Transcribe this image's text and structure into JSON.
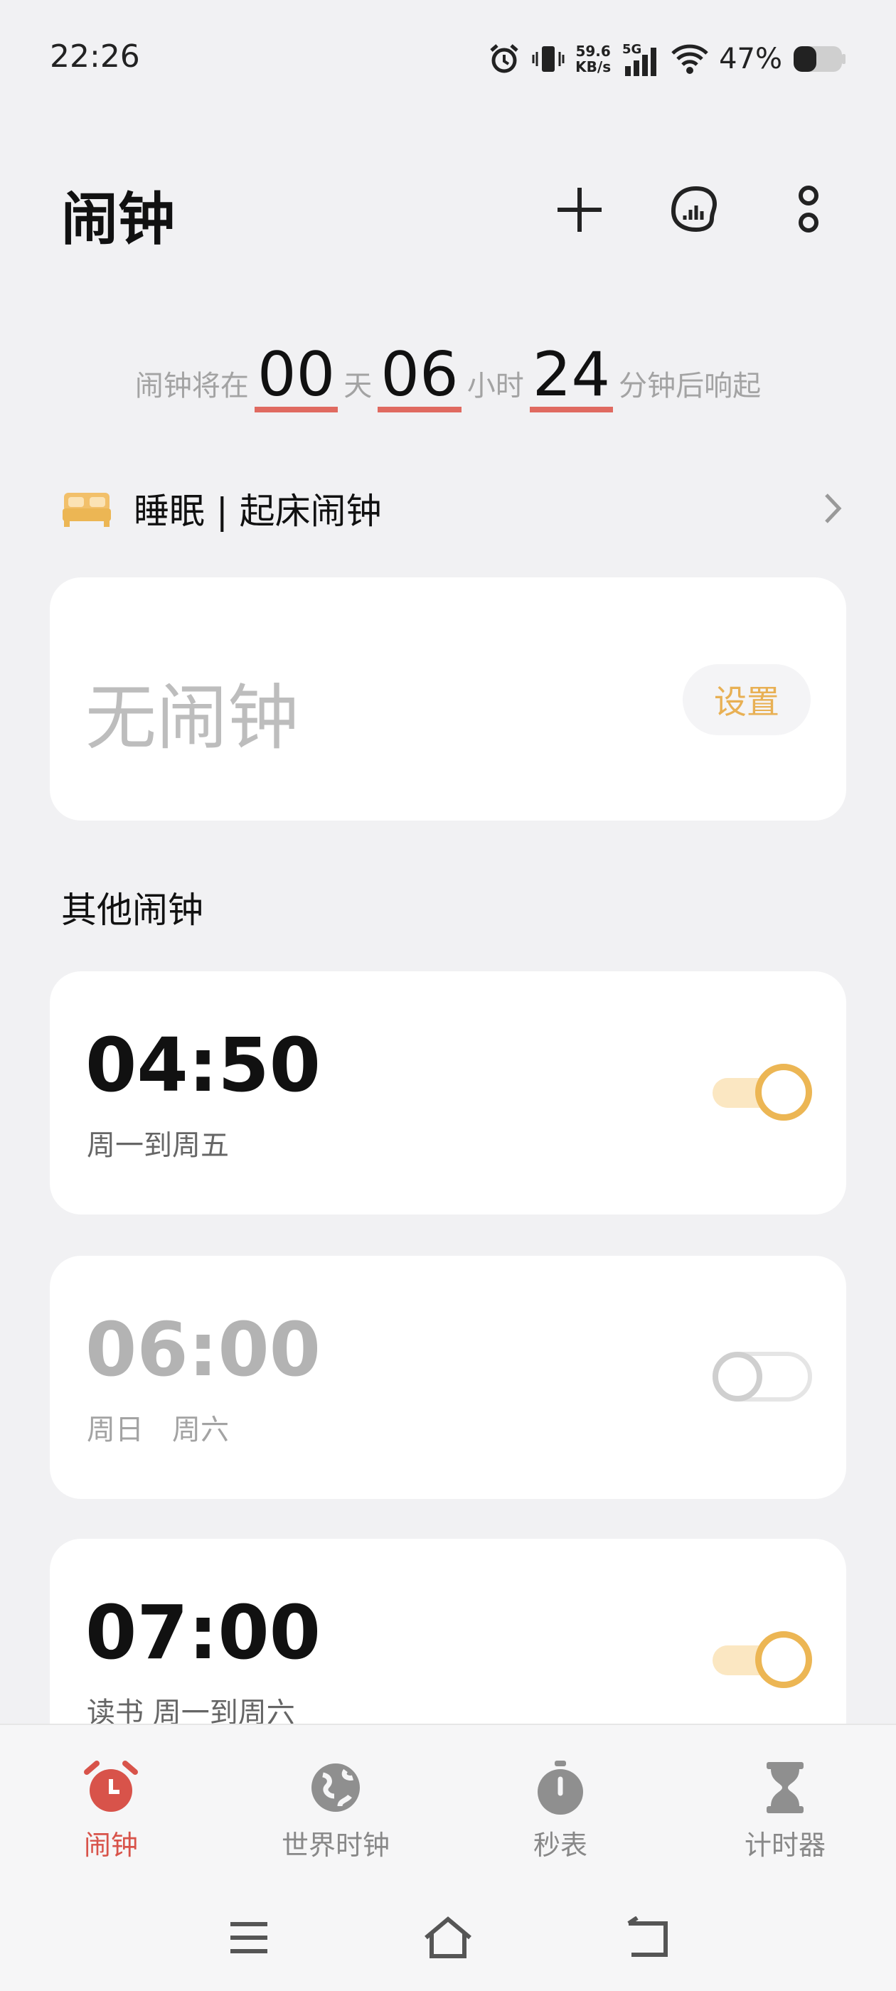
{
  "status_bar": {
    "time": "22:26",
    "net_speed_value": "59.6",
    "net_speed_unit": "KB/s",
    "network": "5G",
    "battery": "47%",
    "icons": [
      "alarm-icon",
      "vibrate-icon",
      "signal-icon",
      "wifi-icon",
      "battery-icon"
    ]
  },
  "header": {
    "title": "闹钟",
    "actions": [
      "add-icon",
      "sleep-stats-icon",
      "more-icon"
    ]
  },
  "countdown": {
    "prefix": "闹钟将在",
    "days": "00",
    "days_label": "天",
    "hours": "06",
    "hours_label": "小时",
    "minutes": "24",
    "minutes_label": "分钟后响起"
  },
  "sleep": {
    "label": "睡眠 | 起床闹钟"
  },
  "no_alarm": {
    "text": "无闹钟",
    "button": "设置"
  },
  "other_alarms": {
    "title": "其他闹钟",
    "items": [
      {
        "time": "04:50",
        "sub": "周一到周五",
        "enabled": true
      },
      {
        "time": "06:00",
        "sub": "周日　周六",
        "enabled": false
      },
      {
        "time": "07:00",
        "sub": "读书 周一到周六",
        "enabled": true
      }
    ]
  },
  "bottom_nav": {
    "items": [
      {
        "label": "闹钟",
        "icon": "alarm-clock-icon",
        "active": true
      },
      {
        "label": "世界时钟",
        "icon": "globe-icon",
        "active": false
      },
      {
        "label": "秒表",
        "icon": "stopwatch-icon",
        "active": false
      },
      {
        "label": "计时器",
        "icon": "hourglass-icon",
        "active": false
      }
    ]
  },
  "colors": {
    "accent": "#ecb654",
    "active_tab": "#d8534a",
    "background": "#f1f1f3"
  }
}
